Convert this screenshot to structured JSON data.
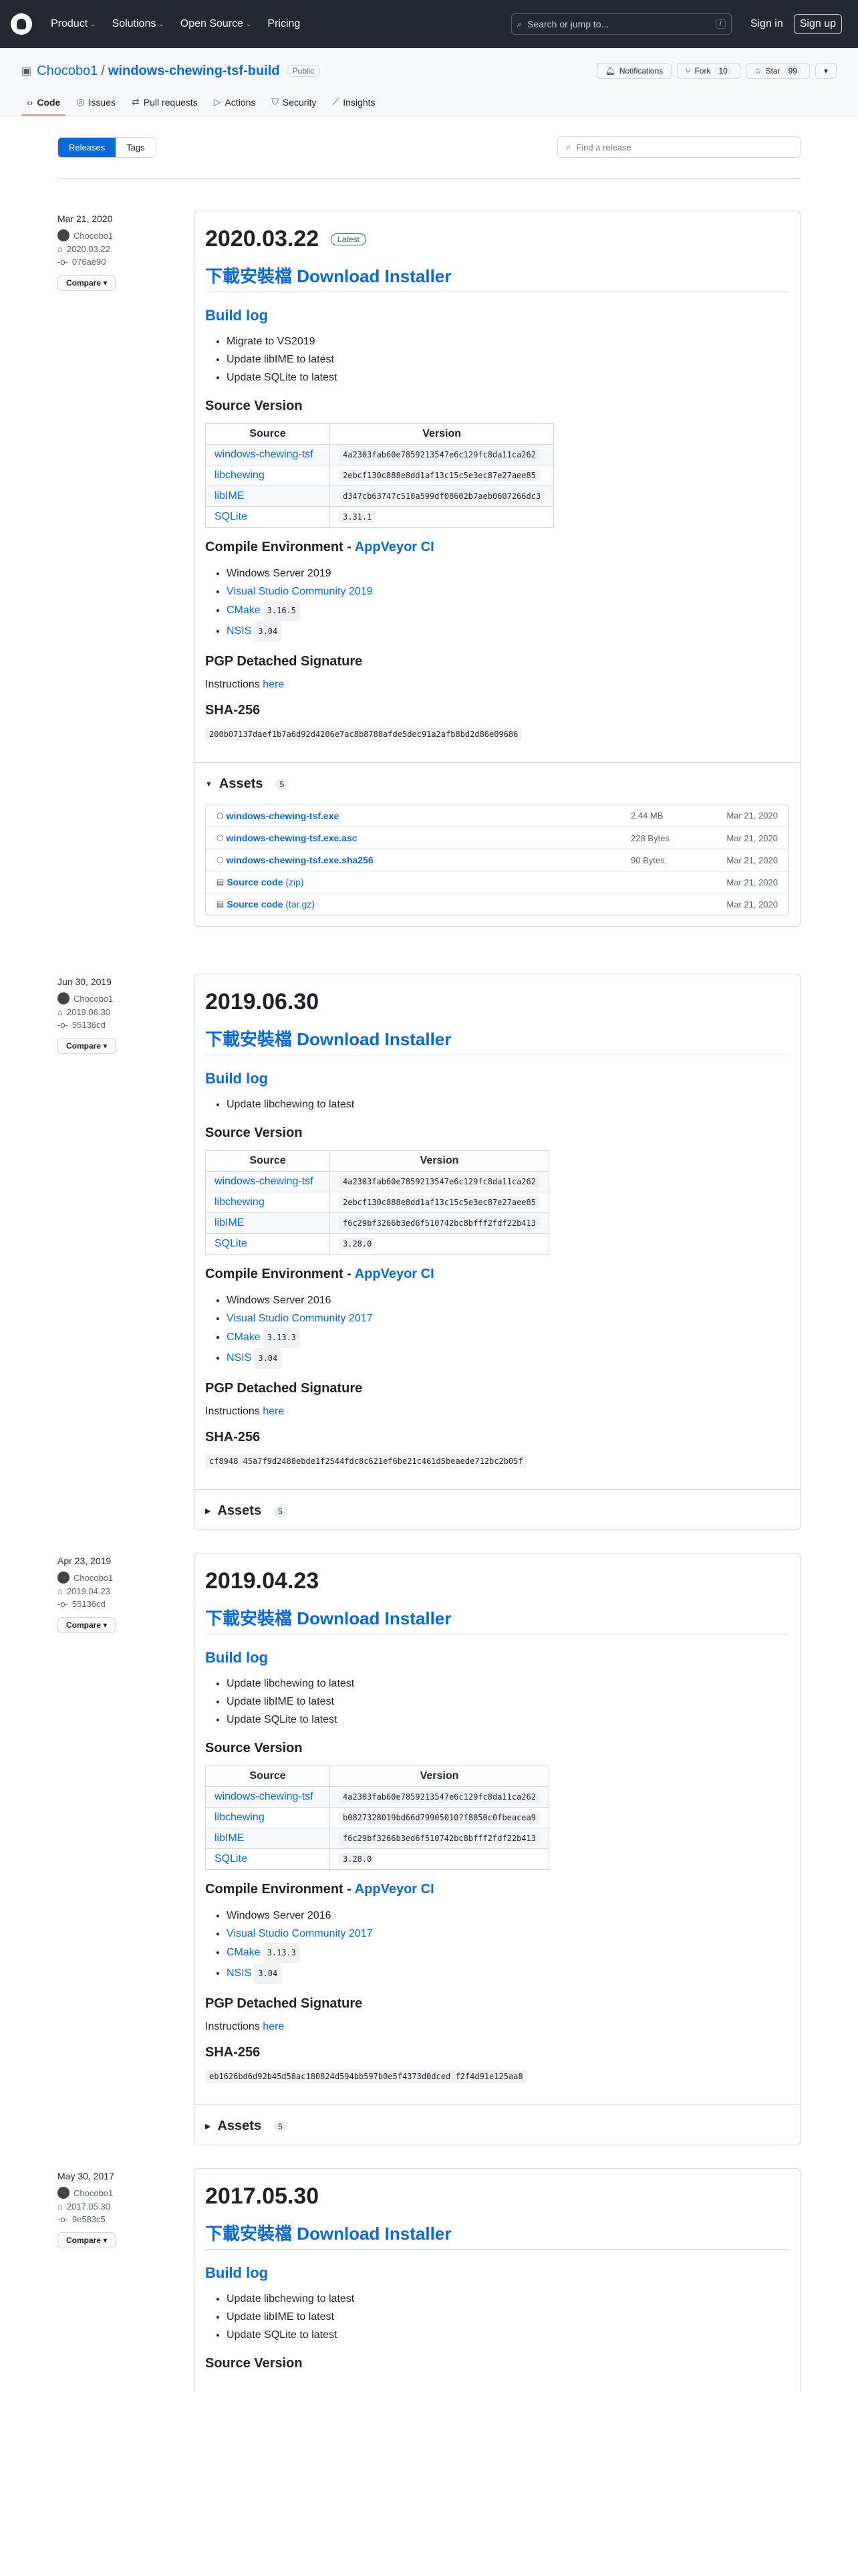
{
  "header": {
    "nav": [
      "Product",
      "Solutions",
      "Open Source",
      "Pricing"
    ],
    "search_placeholder": "Search or jump to...",
    "search_key": "/",
    "signin": "Sign in",
    "signup": "Sign up"
  },
  "repo": {
    "owner": "Chocobo1",
    "name": "windows-chewing-tsf-build",
    "visibility": "Public",
    "notifications": "Notifications",
    "fork_label": "Fork",
    "fork_count": "10",
    "star_label": "Star",
    "star_count": "99",
    "tabs": [
      "Code",
      "Issues",
      "Pull requests",
      "Actions",
      "Security",
      "Insights"
    ]
  },
  "releases_nav": {
    "releases": "Releases",
    "tags": "Tags",
    "find_placeholder": "Find a release"
  },
  "common": {
    "install_heading": "下載安裝檔 Download Installer",
    "build_log": "Build log",
    "source_version": "Source Version",
    "col_source": "Source",
    "col_version": "Version",
    "compile_env": "Compile Environment - ",
    "appveyor": "AppVeyor CI",
    "pgp": "PGP Detached Signature",
    "instructions": "Instructions ",
    "here": "here",
    "sha256": "SHA-256",
    "assets": "Assets",
    "compare": "Compare",
    "latest": "Latest"
  },
  "releases": [
    {
      "date": "Mar 21, 2020",
      "author": "Chocobo1",
      "tag": "2020.03.22",
      "commit": "076ae90",
      "title": "2020.03.22",
      "build_log": [
        "Migrate to VS2019",
        "Update libIME to latest",
        "Update SQLite to latest"
      ],
      "sources": [
        {
          "name": "windows-chewing-tsf",
          "version": "4a2303fab60e7859213547e6c129fc8da11ca262"
        },
        {
          "name": "libchewing",
          "version": "2ebcf130c888e8dd1af13c15c5e3ec87e27aee85"
        },
        {
          "name": "libIME",
          "version": "d347cb63747c510a599df08602b7aeb0607266dc3"
        },
        {
          "name": "SQLite",
          "version": "3.31.1"
        }
      ],
      "env": [
        {
          "text": "Windows Server 2019",
          "link": false,
          "badge": ""
        },
        {
          "text": "Visual Studio Community 2019",
          "link": true,
          "badge": ""
        },
        {
          "text": "CMake",
          "link": true,
          "badge": "3.16.5"
        },
        {
          "text": "NSIS",
          "link": true,
          "badge": "3.04"
        }
      ],
      "sha": "200b07137daef1b7a6d92d4206e7ac8b8788afde5dec91a2afb8bd2d86e09686",
      "asset_count": "5",
      "assets": [
        {
          "name": "windows-chewing-tsf.exe",
          "sub": "",
          "size": "2.44 MB",
          "date": "Mar 21, 2020"
        },
        {
          "name": "windows-chewing-tsf.exe.asc",
          "sub": "",
          "size": "228 Bytes",
          "date": "Mar 21, 2020"
        },
        {
          "name": "windows-chewing-tsf.exe.sha256",
          "sub": "",
          "size": "90 Bytes",
          "date": "Mar 21, 2020"
        },
        {
          "name": "Source code",
          "sub": "(zip)",
          "size": "",
          "date": "Mar 21, 2020"
        },
        {
          "name": "Source code",
          "sub": "(tar.gz)",
          "size": "",
          "date": "Mar 21, 2020"
        }
      ]
    },
    {
      "date": "Jun 30, 2019",
      "author": "Chocobo1",
      "tag": "2019.06.30",
      "commit": "55136cd",
      "title": "2019.06.30",
      "build_log": [
        "Update libchewing to latest"
      ],
      "sources": [
        {
          "name": "windows-chewing-tsf",
          "version": "4a2303fab60e7859213547e6c129fc8da11ca262"
        },
        {
          "name": "libchewing",
          "version": "2ebcf130c888e8dd1af13c15c5e3ec87e27aee85"
        },
        {
          "name": "libIME",
          "version": "f6c29bf3266b3ed6f510742bc8bfff2fdf22b413"
        },
        {
          "name": "SQLite",
          "version": "3.28.0"
        }
      ],
      "env": [
        {
          "text": "Windows Server 2016",
          "link": false,
          "badge": ""
        },
        {
          "text": "Visual Studio Community 2017",
          "link": true,
          "badge": ""
        },
        {
          "text": "CMake",
          "link": true,
          "badge": "3.13.3"
        },
        {
          "text": "NSIS",
          "link": true,
          "badge": "3.04"
        }
      ],
      "sha": "cf8948 45a7f9d2488ebde1f2544fdc8c621ef6be21c461d5beaede712bc2b05f",
      "asset_count": "5"
    },
    {
      "date": "Apr 23, 2019",
      "author": "Chocobo1",
      "tag": "2019.04.23",
      "commit": "55136cd",
      "title": "2019.04.23",
      "build_log": [
        "Update libchewing to latest",
        "Update libIME to latest",
        "Update SQLite to latest"
      ],
      "sources": [
        {
          "name": "windows-chewing-tsf",
          "version": "4a2303fab60e7859213547e6c129fc8da11ca262"
        },
        {
          "name": "libchewing",
          "version": "b0827328019bd66d79905010?f8850c0fbeacea9"
        },
        {
          "name": "libIME",
          "version": "f6c29bf3266b3ed6f510742bc8bfff2fdf22b413"
        },
        {
          "name": "SQLite",
          "version": "3.28.0"
        }
      ],
      "env": [
        {
          "text": "Windows Server 2016",
          "link": false,
          "badge": ""
        },
        {
          "text": "Visual Studio Community 2017",
          "link": true,
          "badge": ""
        },
        {
          "text": "CMake",
          "link": true,
          "badge": "3.13.3"
        },
        {
          "text": "NSIS",
          "link": true,
          "badge": "3.04"
        }
      ],
      "sha": "eb1626bd6d92b45d58ac180824d594bb597b0e5f4373d0dced f2f4d91e125aa8",
      "asset_count": "5"
    },
    {
      "date": "May 30, 2017",
      "author": "Chocobo1",
      "tag": "2017.05.30",
      "commit": "9e583c5",
      "title": "2017.05.30",
      "build_log": [
        "Update libchewing to latest",
        "Update libIME to latest",
        "Update SQLite to latest"
      ]
    }
  ]
}
